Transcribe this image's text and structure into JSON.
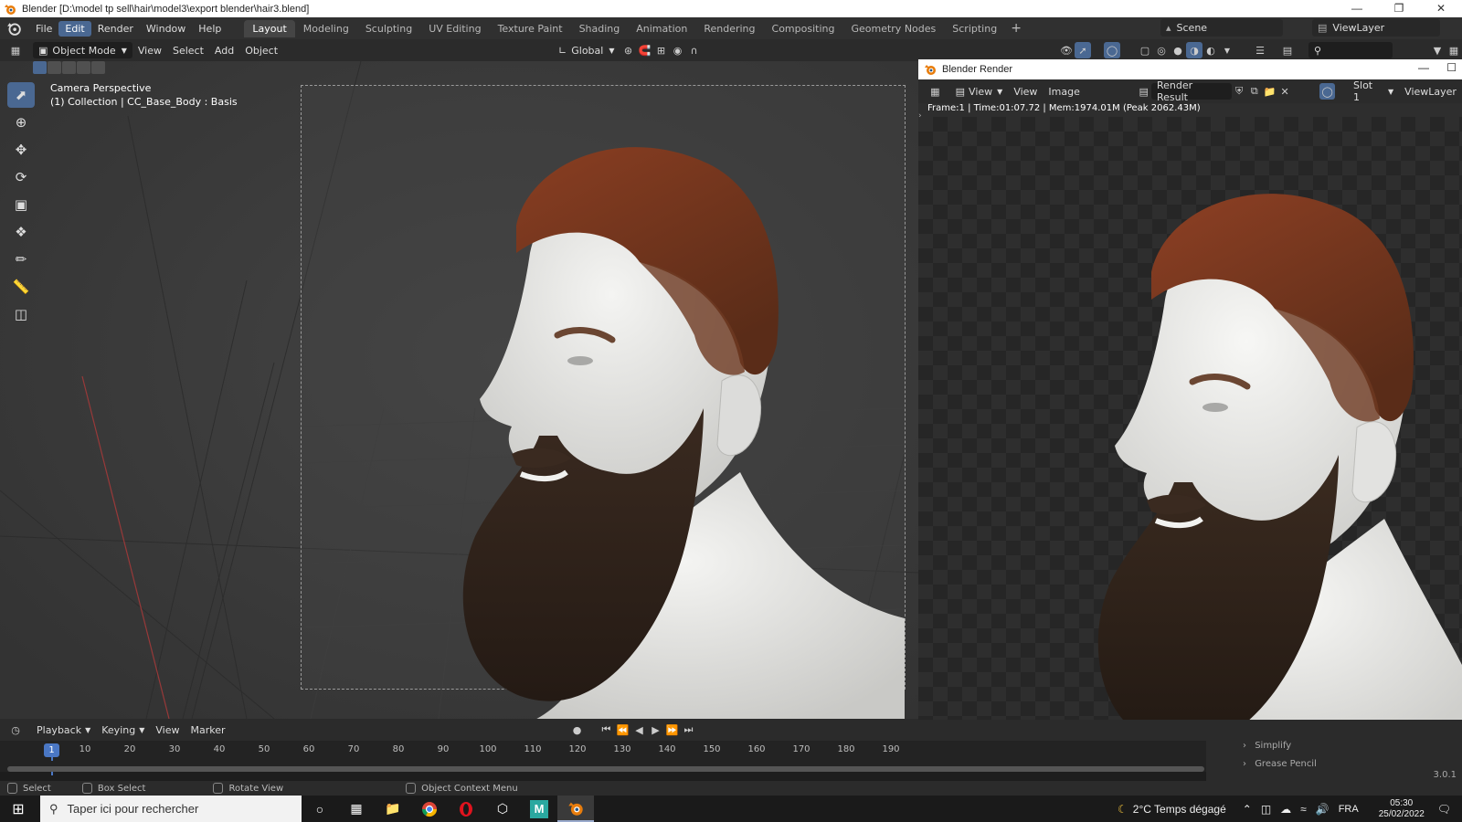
{
  "window": {
    "title": "Blender [D:\\model tp sell\\hair\\model3\\export blender\\hair3.blend]",
    "controls": [
      "—",
      "❐",
      "✕"
    ]
  },
  "menu": {
    "items": [
      "File",
      "Edit",
      "Render",
      "Window",
      "Help"
    ],
    "active": "Edit"
  },
  "workspaces": {
    "tabs": [
      "Layout",
      "Modeling",
      "Sculpting",
      "UV Editing",
      "Texture Paint",
      "Shading",
      "Animation",
      "Rendering",
      "Compositing",
      "Geometry Nodes",
      "Scripting"
    ],
    "active": "Layout",
    "add": "+"
  },
  "scene": {
    "name": "Scene",
    "view_layer": "ViewLayer"
  },
  "header": {
    "mode": "Object Mode",
    "menus": [
      "View",
      "Select",
      "Add",
      "Object"
    ],
    "orientation": "Global"
  },
  "viewport": {
    "info_line1": "Camera Perspective",
    "info_line2": "(1) Collection | CC_Base_Body : Basis",
    "tools": [
      "select-box",
      "cursor",
      "move",
      "rotate",
      "scale",
      "transform",
      "annotate",
      "measure",
      "add-cube"
    ]
  },
  "render_window": {
    "title": "Blender Render",
    "view_menu": "View",
    "menus": [
      "View",
      "Image"
    ],
    "image_name": "Render Result",
    "slot": "Slot 1",
    "view_layer": "ViewLayer",
    "info": "Frame:1 | Time:01:07.72 | Mem:1974.01M (Peak 2062.43M)"
  },
  "timeline": {
    "menus": [
      "Playback",
      "Keying",
      "View",
      "Marker"
    ],
    "current_frame": "1",
    "frames": [
      "10",
      "20",
      "30",
      "40",
      "50",
      "60",
      "70",
      "80",
      "90",
      "100",
      "110",
      "120",
      "130",
      "140",
      "150",
      "160",
      "170",
      "180",
      "190"
    ]
  },
  "properties_strip": {
    "items": [
      "Simplify",
      "Grease Pencil"
    ],
    "version": "3.0.1"
  },
  "statusbar": {
    "items": [
      "Select",
      "Box Select",
      "Rotate View",
      "Object Context Menu"
    ]
  },
  "taskbar": {
    "search_placeholder": "Taper ici pour rechercher",
    "weather": "2°C  Temps dégagé",
    "language": "FRA",
    "time": "05:30",
    "date": "25/02/2022"
  },
  "colors": {
    "accent": "#4a6892",
    "frame_marker": "#4a77c4",
    "hair": "#7a3a22",
    "beard": "#2e2119",
    "skin": "#e8e8e6"
  }
}
